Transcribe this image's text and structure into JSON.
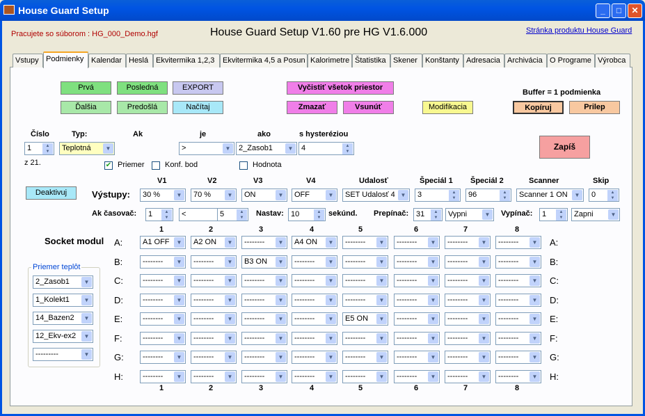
{
  "window": {
    "title": "House Guard Setup"
  },
  "header": {
    "file_status": "Pracujete so súborom : HG_000_Demo.hgf",
    "app_title": "House Guard Setup V1.60 pre HG V1.6.000",
    "product_link": "Stránka produktu House Guard"
  },
  "tabs": [
    "Vstupy",
    "Podmienky",
    "Kalendar",
    "Heslá",
    "Ekvitermika 1,2,3",
    "Ekvitermika 4,5 a Posun",
    "Kalorimetre",
    "Štatistika",
    "Skener",
    "Konštanty",
    "Adresacia",
    "Archivácia",
    "O Programe",
    "Výrobca"
  ],
  "buttons": {
    "prva": "Prvá",
    "posledna": "Posledná",
    "export": "EXPORT",
    "dalsia": "Ďalšia",
    "predosla": "Predošlá",
    "nacitaj": "Načítaj",
    "vycistit": "Vyčistiť všetok priestor",
    "zmazat": "Zmazať",
    "vsunut": "Vsunúť",
    "modifikacia": "Modifikacia",
    "kopiruj": "Kopíruj",
    "prilep": "Prilep",
    "zapis": "Zapíš",
    "deaktivuj": "Deaktivuj"
  },
  "buffer_label": "Buffer = 1 podmienka",
  "condition": {
    "cislo_label": "Číslo",
    "typ_label": "Typ:",
    "ak_label": "Ak",
    "je_label": "je",
    "ako_label": "ako",
    "hyst_label": "s hysteréziou",
    "cislo": "1",
    "z_label": "z 21.",
    "typ": "Teplotná",
    "je": ">",
    "ako": "2_Zasob1",
    "hyst": "4",
    "priemer": "Priemer",
    "konf_bod": "Konf. bod",
    "hodnota": "Hodnota"
  },
  "outputs": {
    "headers": [
      "V1",
      "V2",
      "V3",
      "V4",
      "Udalosť",
      "Špeciál 1",
      "Špeciál 2",
      "Scanner",
      "Skip"
    ],
    "label": "Výstupy:",
    "values": [
      "30 %",
      "70 %",
      "ON",
      "OFF",
      "SET Udalosť 4",
      "3",
      "96",
      "Scanner 1 ON",
      "0"
    ]
  },
  "timer": {
    "label": "Ak časovač:",
    "val1": "1",
    "op": "<",
    "val2": "5",
    "nastav_label": "Nastav:",
    "nastav": "10",
    "sekund": "sekúnd.",
    "prepinac_label": "Prepínač:",
    "prepinac": "31",
    "prepinac_sel": "Vypni",
    "vypinac_label": "Vypínač:",
    "vypinac": "1",
    "vypinac_sel": "Zapni"
  },
  "socket": {
    "title": "Socket modul",
    "columns": [
      "1",
      "2",
      "3",
      "4",
      "5",
      "6",
      "7",
      "8"
    ],
    "rows": [
      {
        "label": "A:",
        "cells": [
          "A1 OFF",
          "A2 ON",
          "--------",
          "A4 ON",
          "--------",
          "--------",
          "--------",
          "--------"
        ]
      },
      {
        "label": "B:",
        "cells": [
          "--------",
          "--------",
          "B3 ON",
          "--------",
          "--------",
          "--------",
          "--------",
          "--------"
        ]
      },
      {
        "label": "C:",
        "cells": [
          "--------",
          "--------",
          "--------",
          "--------",
          "--------",
          "--------",
          "--------",
          "--------"
        ]
      },
      {
        "label": "D:",
        "cells": [
          "--------",
          "--------",
          "--------",
          "--------",
          "--------",
          "--------",
          "--------",
          "--------"
        ]
      },
      {
        "label": "E:",
        "cells": [
          "--------",
          "--------",
          "--------",
          "--------",
          "E5 ON",
          "--------",
          "--------",
          "--------"
        ]
      },
      {
        "label": "F:",
        "cells": [
          "--------",
          "--------",
          "--------",
          "--------",
          "--------",
          "--------",
          "--------",
          "--------"
        ]
      },
      {
        "label": "G:",
        "cells": [
          "--------",
          "--------",
          "--------",
          "--------",
          "--------",
          "--------",
          "--------",
          "--------"
        ]
      },
      {
        "label": "H:",
        "cells": [
          "--------",
          "--------",
          "--------",
          "--------",
          "--------",
          "--------",
          "--------",
          "--------"
        ]
      }
    ]
  },
  "priemer_teplot": {
    "title": "Priemer teplôt",
    "items": [
      "2_Zasob1",
      "1_Kolekt1",
      "14_Bazen2",
      "12_Ekv-ex2",
      "---------"
    ]
  }
}
